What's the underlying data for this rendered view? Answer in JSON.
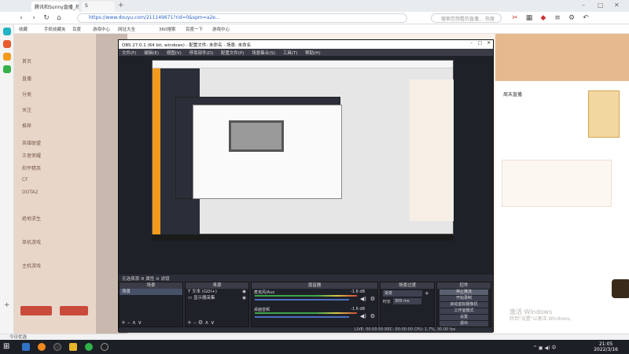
{
  "browser": {
    "tabs": [
      {
        "label": "腾讯和Sunny直播_热门游戏直播"
      },
      {
        "label": "S"
      }
    ],
    "url": "https://www.douyu.com/211149671?rid=0&spm=a2e...",
    "search_placeholder": "搜索您想看的直播…  热搜",
    "bookmarks": [
      "收藏",
      "手机收藏夹",
      "百度",
      "游戏中心",
      "网址大全",
      "360搜索",
      "百度一下",
      "游戏中心"
    ],
    "status_text": "今日优选"
  },
  "page": {
    "sidebar_items": [
      "首页",
      "直播",
      "分类",
      "关注",
      "推荐",
      "英雄联盟",
      "王者荣耀",
      "和平精英",
      "CF",
      "DOTA2",
      "绝地求生",
      "单机游戏",
      "主机游戏"
    ],
    "right_text": "周末直播"
  },
  "obs": {
    "title": "OBS 27.0.1 (64 bit, windows) - 配置文件: 未命名 - 场景: 未命名",
    "menu": [
      "文件(F)",
      "编辑(E)",
      "视图(V)",
      "停靠部件(D)",
      "配置文件(P)",
      "场景集合(S)",
      "工具(T)",
      "帮助(H)"
    ],
    "stream_bar": "无选择源   ⚙ 属性   ⊘ 滤镜",
    "panels": {
      "scenes": {
        "title": "场景",
        "items": [
          "场景"
        ]
      },
      "sources": {
        "title": "来源",
        "items": [
          "文本 (GDI+)",
          "显示器采集"
        ]
      },
      "mixer": {
        "title": "混音器",
        "channels": [
          {
            "name": "麦克风/Aux",
            "db": "-1.6 dB"
          },
          {
            "name": "桌面音频",
            "db": "-1.6 dB"
          }
        ]
      },
      "transitions": {
        "title": "场景过渡",
        "type": "渐变",
        "duration_label": "时长",
        "duration": "300 ms"
      },
      "controls": {
        "title": "控件",
        "buttons": [
          "停止推流",
          "开始录制",
          "启动虚拟摄像机",
          "工作室模式",
          "设置",
          "退出"
        ]
      }
    },
    "status": "LIVE: 00:00:00   REC: 00:00:00   CPU: 1.7%, 30.00 fps"
  },
  "windows": {
    "activate_line1": "激活 Windows",
    "activate_line2": "转到\"设置\"以激活 Windows。",
    "time": "21:05",
    "date": "2022/3/16"
  }
}
